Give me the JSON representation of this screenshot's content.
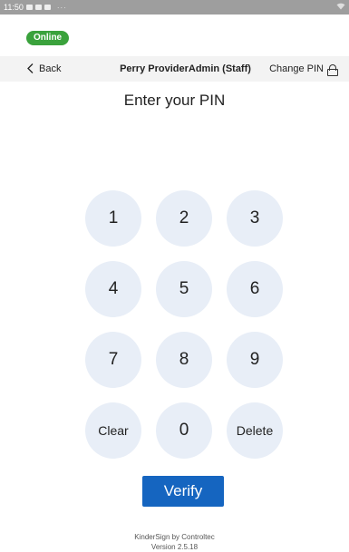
{
  "status_bar": {
    "time": "11:50",
    "extra": "···"
  },
  "connection": {
    "status": "Online",
    "color": "#3aa23c"
  },
  "header": {
    "back_label": "Back",
    "user_name": "Perry ProviderAdmin (Staff)",
    "change_pin_label": "Change PIN"
  },
  "title": "Enter your PIN",
  "keypad": {
    "keys": [
      "1",
      "2",
      "3",
      "4",
      "5",
      "6",
      "7",
      "8",
      "9",
      "Clear",
      "0",
      "Delete"
    ]
  },
  "verify_label": "Verify",
  "footer": {
    "app": "KinderSign by Controltec",
    "version": "Version 2.5.18"
  },
  "colors": {
    "key_background": "#e8eef7",
    "accent": "#1565c0",
    "header_background": "#f3f3f3"
  }
}
